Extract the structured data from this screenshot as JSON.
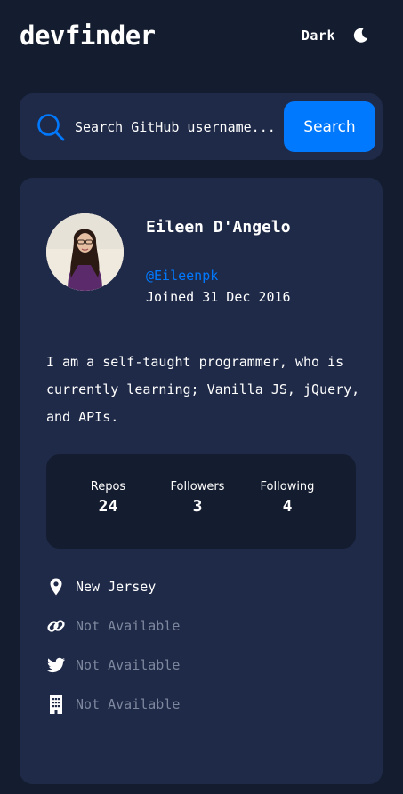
{
  "header": {
    "logo": "devfinder",
    "theme_label": "Dark",
    "theme_icon": "moon-icon"
  },
  "search": {
    "placeholder": "Search GitHub username...",
    "button_label": "Search",
    "icon": "search-icon"
  },
  "profile": {
    "name": "Eileen D'Angelo",
    "handle": "@Eileenpk",
    "joined": "Joined 31 Dec 2016",
    "bio": "I am a self-taught programmer, who is currently learning; Vanilla JS, jQuery, and APIs.",
    "stats": [
      {
        "label": "Repos",
        "value": "24"
      },
      {
        "label": "Followers",
        "value": "3"
      },
      {
        "label": "Following",
        "value": "4"
      }
    ],
    "links": [
      {
        "icon": "location-icon",
        "text": "New Jersey",
        "available": true
      },
      {
        "icon": "link-icon",
        "text": "Not Available",
        "available": false
      },
      {
        "icon": "twitter-icon",
        "text": "Not Available",
        "available": false
      },
      {
        "icon": "company-icon",
        "text": "Not Available",
        "available": false
      }
    ]
  },
  "colors": {
    "background": "#141c2f",
    "card": "#1f2a48",
    "accent": "#0079ff",
    "muted": "#7d879d",
    "text": "#ffffff"
  }
}
